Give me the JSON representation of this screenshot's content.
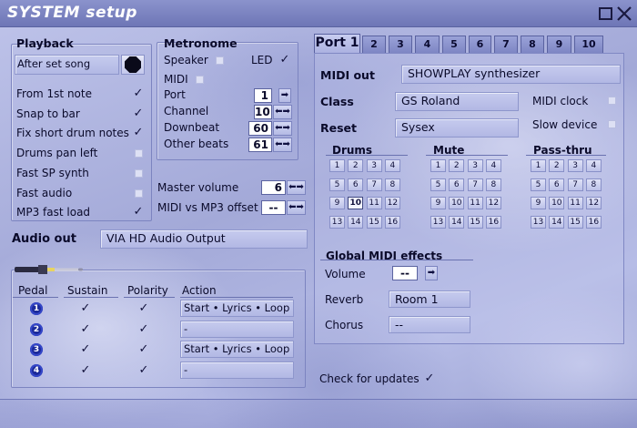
{
  "window": {
    "title": "SYSTEM setup"
  },
  "playback": {
    "legend": "Playback",
    "after_set_song": "After set song",
    "options": [
      {
        "label": "From 1st note",
        "checked": true
      },
      {
        "label": "Snap to bar",
        "checked": true
      },
      {
        "label": "Fix short drum notes",
        "checked": true
      },
      {
        "label": "Drums pan left",
        "checked": false
      },
      {
        "label": "Fast SP synth",
        "checked": false
      },
      {
        "label": "Fast audio",
        "checked": false
      },
      {
        "label": "MP3 fast load",
        "checked": true
      }
    ]
  },
  "metronome": {
    "legend": "Metronome",
    "speaker_label": "Speaker",
    "led_label": "LED",
    "midi_label": "MIDI",
    "port_label": "Port",
    "port_value": "1",
    "channel_label": "Channel",
    "channel_value": "10",
    "downbeat_label": "Downbeat",
    "downbeat_value": "60",
    "otherbeats_label": "Other beats",
    "otherbeats_value": "61"
  },
  "master": {
    "volume_label": "Master volume",
    "volume_value": "6",
    "offset_label": "MIDI vs MP3 offset",
    "offset_value": "--"
  },
  "audio_out": {
    "label": "Audio out",
    "value": "VIA HD Audio Output"
  },
  "pedals": {
    "headers": {
      "pedal": "Pedal",
      "sustain": "Sustain",
      "polarity": "Polarity",
      "action": "Action"
    },
    "rows": [
      {
        "num": "1",
        "action": "Start • Lyrics • Loop"
      },
      {
        "num": "2",
        "action": "-"
      },
      {
        "num": "3",
        "action": "Start • Lyrics • Loop"
      },
      {
        "num": "4",
        "action": "-"
      }
    ]
  },
  "ports": {
    "tabs": [
      "Port 1",
      "2",
      "3",
      "4",
      "5",
      "6",
      "7",
      "8",
      "9",
      "10"
    ],
    "midi_out_label": "MIDI out",
    "midi_out_value": "SHOWPLAY synthesizer",
    "class_label": "Class",
    "class_value": "GS  Roland",
    "reset_label": "Reset",
    "reset_value": "Sysex",
    "midi_clock_label": "MIDI clock",
    "slow_device_label": "Slow device",
    "drums_label": "Drums",
    "mute_label": "Mute",
    "passthru_label": "Pass-thru",
    "channels": [
      "1",
      "2",
      "3",
      "4",
      "5",
      "6",
      "7",
      "8",
      "9",
      "10",
      "11",
      "12",
      "13",
      "14",
      "15",
      "16"
    ],
    "drums_selected": "10",
    "global_fx_label": "Global MIDI effects",
    "volume_label": "Volume",
    "volume_value": "--",
    "reverb_label": "Reverb",
    "reverb_value": "Room 1",
    "chorus_label": "Chorus",
    "chorus_value": "--"
  },
  "updates": {
    "label": "Check for updates"
  },
  "icons": {
    "check": "✓",
    "arrow_right": "➡",
    "arrow_both": "⬅➡"
  },
  "colors": {
    "title_text": "#ffffff",
    "pedal_icon": "#1c2a9a"
  }
}
